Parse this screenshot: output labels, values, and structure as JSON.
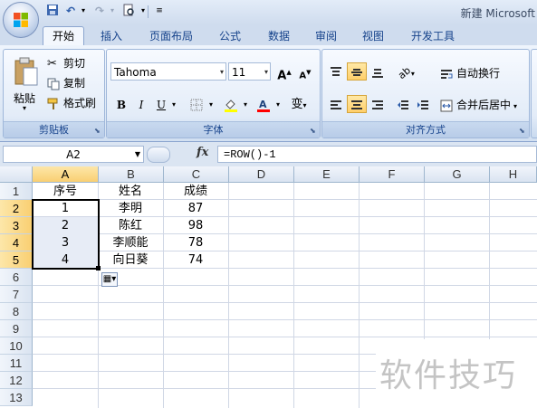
{
  "window": {
    "title": "新建 Microsoft"
  },
  "tabs": [
    "开始",
    "插入",
    "页面布局",
    "公式",
    "数据",
    "审阅",
    "视图",
    "开发工具"
  ],
  "clipboard": {
    "paste_label": "粘贴",
    "cut_label": "剪切",
    "copy_label": "复制",
    "format_painter_label": "格式刷",
    "group_label": "剪贴板"
  },
  "font": {
    "name": "Tahoma",
    "size": "11",
    "grow_label": "A",
    "shrink_label": "A",
    "bold_label": "B",
    "italic_label": "I",
    "underline_label": "U",
    "phonetic_label": "变",
    "group_label": "字体",
    "font_color": "#ff0000",
    "fill_color": "#ffff00"
  },
  "alignment": {
    "wrap_label": "自动换行",
    "merge_label": "合并后居中",
    "group_label": "对齐方式"
  },
  "formula_bar": {
    "name_box": "A2",
    "fx_label": "fx",
    "formula": "=ROW()-1"
  },
  "sheet": {
    "columns": [
      "A",
      "B",
      "C",
      "D",
      "E",
      "F",
      "G",
      "H"
    ],
    "rows": [
      "1",
      "2",
      "3",
      "4",
      "5",
      "6",
      "7",
      "8",
      "9",
      "10",
      "11",
      "12",
      "13"
    ],
    "header_row": [
      "序号",
      "姓名",
      "成绩"
    ],
    "data_rows": [
      [
        "1",
        "李明",
        "87"
      ],
      [
        "2",
        "陈红",
        "98"
      ],
      [
        "3",
        "李顺能",
        "78"
      ],
      [
        "4",
        "向日葵",
        "74"
      ]
    ],
    "active_cell": "A2",
    "selection": "A2:A5"
  },
  "watermark": "软件技巧"
}
